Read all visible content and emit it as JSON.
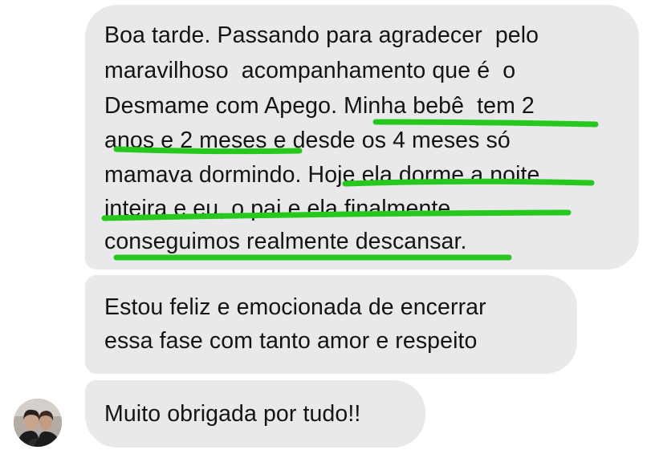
{
  "messages": [
    {
      "lines": [
        "Boa tarde. Passando para agradecer  pelo",
        "maravilhoso  acompanhamento que é  o",
        "Desmame com Apego. Minha bebê  tem 2",
        "anos e 2 meses e desde os 4 meses só",
        "mamava dormindo. Hoje ela dorme a noite",
        "inteira e eu, o pai e ela finalmente",
        "conseguimos realmente descansar."
      ]
    },
    {
      "lines": [
        "Estou feliz e emocionada de encerrar",
        "essa fase com tanto amor e respeito"
      ]
    },
    {
      "lines": [
        "Muito obrigada por tudo!!"
      ]
    }
  ],
  "colors": {
    "bubble_background": "#e9e9eb",
    "text": "#141414",
    "highlight_underline": "#27c81d"
  },
  "sender_avatar": {
    "icon": "profile-photo-two-people"
  }
}
